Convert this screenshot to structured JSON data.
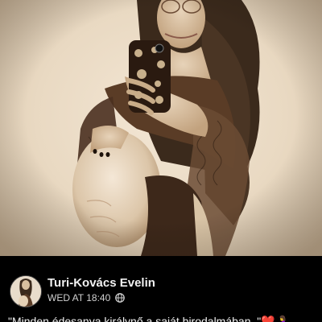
{
  "post": {
    "author_name": "Turi-Kovács Evelin",
    "timestamp": "WED AT 18:40",
    "privacy_icon": "globe-icon",
    "caption": "\"Minden édesanya királynő a saját birodalmában..\"❤️🤰"
  },
  "photo": {
    "description_icon": "post-photo",
    "tone": "sepia"
  },
  "colors": {
    "background": "#000000",
    "text_primary": "#f2f2f2",
    "text_secondary": "#d0d0d0"
  }
}
